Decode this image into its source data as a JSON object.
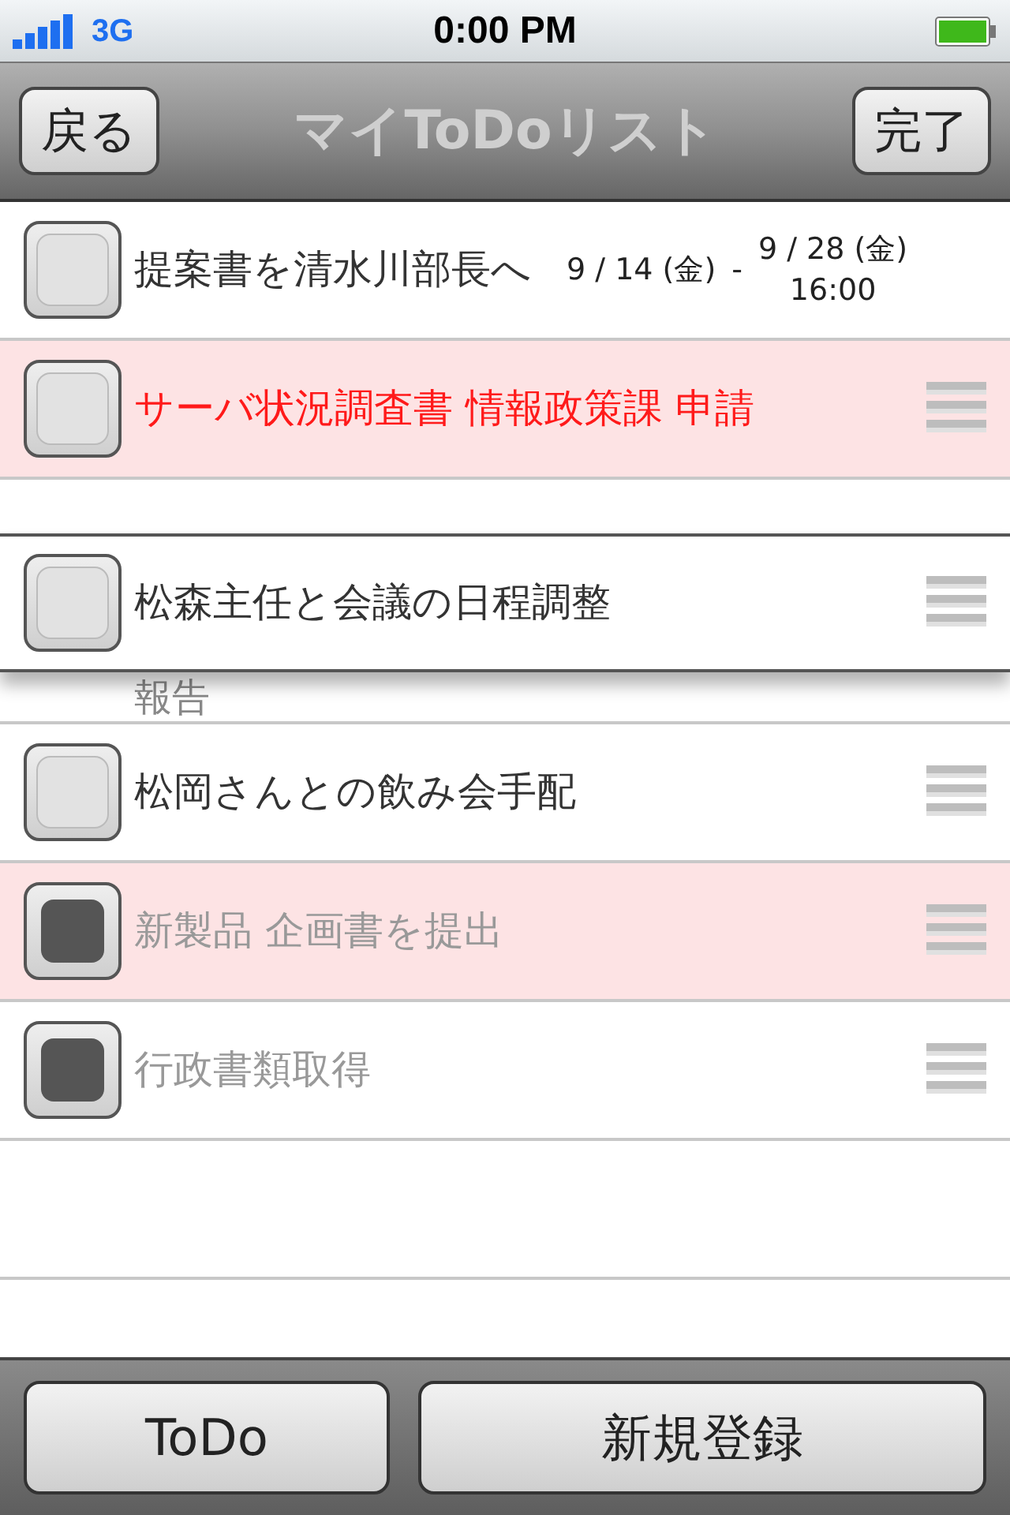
{
  "status_bar": {
    "carrier": "3G",
    "time": "0:00 PM"
  },
  "nav": {
    "back": "戻る",
    "title": "マイToDoリスト",
    "done": "完了"
  },
  "rows": [
    {
      "text": "提案書を清水川部長へ",
      "checked": false,
      "highlighted": false,
      "alert": false,
      "start": "9 / 14 (金)",
      "dash": "-",
      "end": "9 / 28 (金)",
      "end_time": "16:00"
    },
    {
      "text": "サーバ状況調査書 情報政策課 申請",
      "checked": false,
      "highlighted": true,
      "alert": true
    },
    {
      "kind": "placeholder",
      "under_text": "報告"
    },
    {
      "text": "松岡さんとの飲み会手配",
      "checked": false,
      "highlighted": false,
      "alert": false
    },
    {
      "text": "新製品 企画書を提出",
      "checked": true,
      "highlighted": true,
      "alert": false
    },
    {
      "text": "行政書類取得",
      "checked": true,
      "highlighted": false,
      "alert": false
    },
    {
      "kind": "empty"
    }
  ],
  "dragged_row": {
    "text": "松森主任と会議の日程調整",
    "checked": false
  },
  "toolbar": {
    "buttons": [
      "ToDo",
      "新規登録"
    ]
  }
}
